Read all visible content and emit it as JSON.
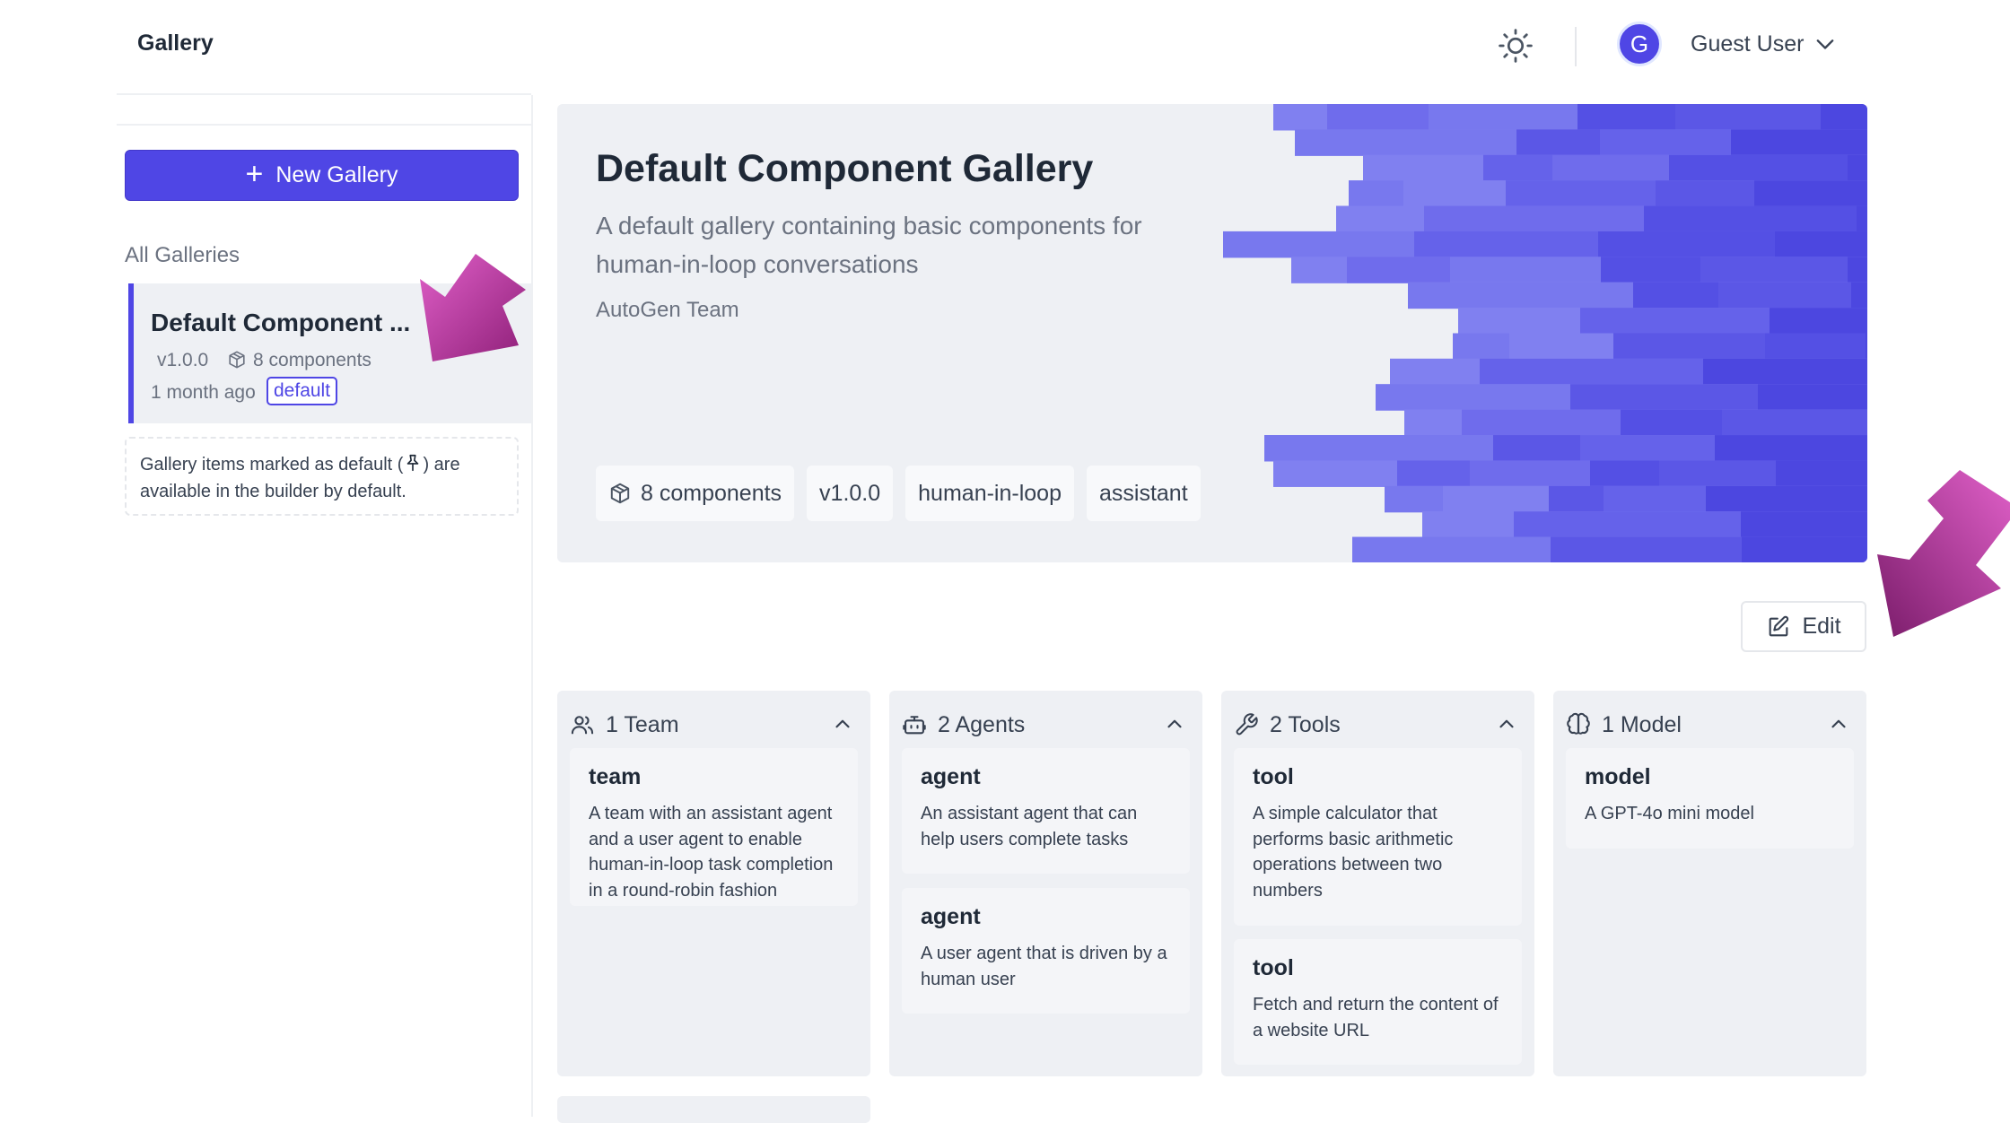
{
  "header": {
    "title": "Gallery",
    "user_initial": "G",
    "user_name": "Guest User"
  },
  "sidebar": {
    "new_gallery_label": "New Gallery",
    "all_galleries_label": "All Galleries",
    "gallery_item": {
      "title": "Default Component ...",
      "version": "v1.0.0",
      "components": "8 components",
      "time": "1 month ago",
      "badge": "default"
    },
    "info_before": "Gallery items marked as default (",
    "info_after": ") are available in the builder by default."
  },
  "hero": {
    "title": "Default Component Gallery",
    "description": "A default gallery containing basic components for human-in-loop conversations",
    "author": "AutoGen Team",
    "tags": [
      "8 components",
      "v1.0.0",
      "human-in-loop",
      "assistant"
    ]
  },
  "edit_label": "Edit",
  "sections": [
    {
      "icon": "users-icon",
      "heading": "1 Team",
      "items": [
        {
          "title": "team",
          "desc": "A team with an assistant agent and a user agent to enable human-in-loop task completion in a round-robin fashion"
        }
      ]
    },
    {
      "icon": "bot-icon",
      "heading": "2 Agents",
      "items": [
        {
          "title": "agent",
          "desc": "An assistant agent that can help users complete tasks"
        },
        {
          "title": "agent",
          "desc": "A user agent that is driven by a human user"
        }
      ]
    },
    {
      "icon": "wrench-icon",
      "heading": "2 Tools",
      "items": [
        {
          "title": "tool",
          "desc": "A simple calculator that performs basic arithmetic operations between two numbers"
        },
        {
          "title": "tool",
          "desc": "Fetch and return the content of a website URL"
        }
      ]
    },
    {
      "icon": "brain-icon",
      "heading": "1 Model",
      "items": [
        {
          "title": "model",
          "desc": "A GPT-4o mini model"
        }
      ]
    }
  ],
  "colors": {
    "accent": "#4f46e5",
    "annotation_arrow": "#b02a8f"
  }
}
